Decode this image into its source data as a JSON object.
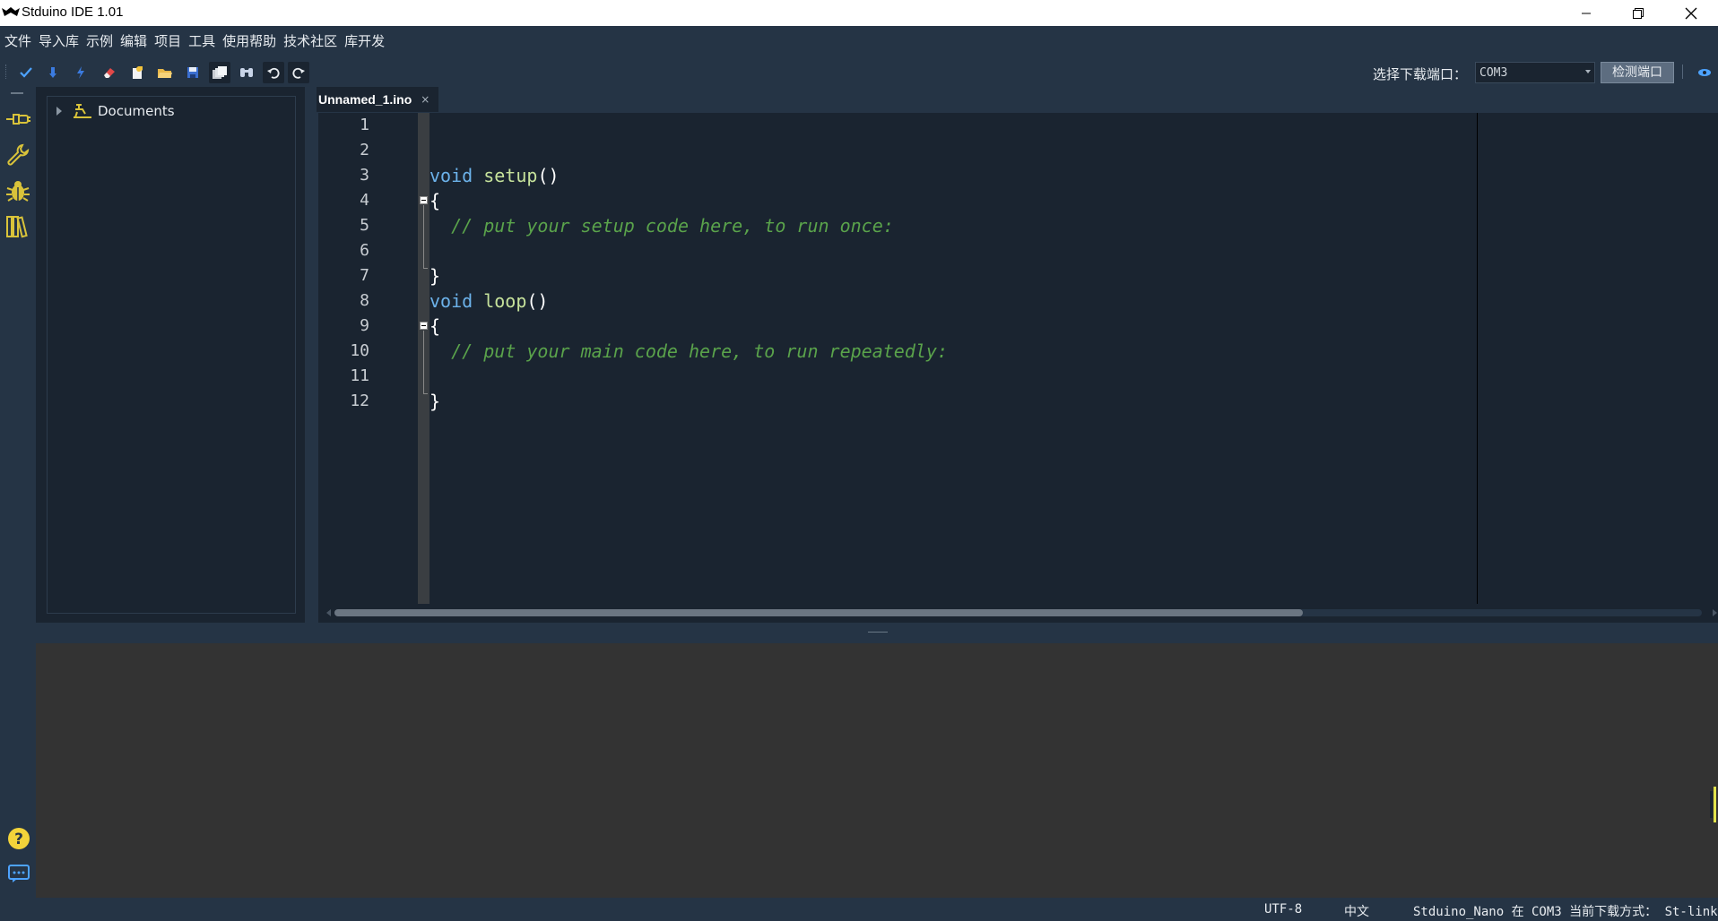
{
  "window": {
    "title": "Stduino IDE 1.01",
    "icons": [
      "minimize-icon",
      "restore-icon",
      "close-icon"
    ]
  },
  "menu": {
    "items": [
      "文件",
      "导入库",
      "示例",
      "编辑",
      "项目",
      "工具",
      "使用帮助",
      "技术社区",
      "库开发"
    ]
  },
  "toolbar": {
    "buttons": [
      "verify-icon",
      "upload-icon",
      "flash-icon",
      "erase-icon",
      "new-file-icon",
      "open-folder-icon",
      "save-icon",
      "save-all-icon",
      "find-icon",
      "undo-icon",
      "redo-icon"
    ],
    "port_label": "选择下载端口：",
    "port_value": "COM3",
    "detect_label": "检测端口"
  },
  "sidebar": {
    "icons": [
      "serial-plug-icon",
      "wrench-icon",
      "bug-icon",
      "library-icon"
    ],
    "bottom_icons": [
      "help-icon",
      "chat-icon"
    ]
  },
  "explorer": {
    "root_label": "Documents"
  },
  "editor": {
    "tab_label": "Unnamed_1.ino",
    "tab_close": "×",
    "line_numbers": [
      "1",
      "2",
      "3",
      "4",
      "5",
      "6",
      "7",
      "8",
      "9",
      "10",
      "11",
      "12"
    ],
    "lines": [
      {
        "kw": "",
        "fn": "",
        "plain": "",
        "cm": ""
      },
      {
        "kw": "",
        "fn": "",
        "plain": "",
        "cm": ""
      },
      {
        "kw": "void",
        "fn": "setup",
        "plain": "()",
        "cm": ""
      },
      {
        "kw": "",
        "fn": "",
        "plain": "{",
        "cm": ""
      },
      {
        "kw": "",
        "fn": "",
        "plain": "  ",
        "cm": "// put your setup code here, to run once:"
      },
      {
        "kw": "",
        "fn": "",
        "plain": "",
        "cm": ""
      },
      {
        "kw": "",
        "fn": "",
        "plain": "}",
        "cm": ""
      },
      {
        "kw": "void",
        "fn": "loop",
        "plain": "()",
        "cm": ""
      },
      {
        "kw": "",
        "fn": "",
        "plain": "{",
        "cm": ""
      },
      {
        "kw": "",
        "fn": "",
        "plain": "  ",
        "cm": "// put your main code here, to run repeatedly:"
      },
      {
        "kw": "",
        "fn": "",
        "plain": "",
        "cm": ""
      },
      {
        "kw": "",
        "fn": "",
        "plain": "}",
        "cm": ""
      }
    ]
  },
  "status": {
    "encoding": "UTF-8",
    "language": "中文",
    "board": "Stduino_Nano 在 COM3 当前下载方式： St-link"
  },
  "colors": {
    "chrome": "#253445",
    "editor_bg": "#1a2430",
    "keyword": "#6cb2ea",
    "function": "#c6e29b",
    "comment": "#5aa34b",
    "console_bg": "#333333"
  }
}
